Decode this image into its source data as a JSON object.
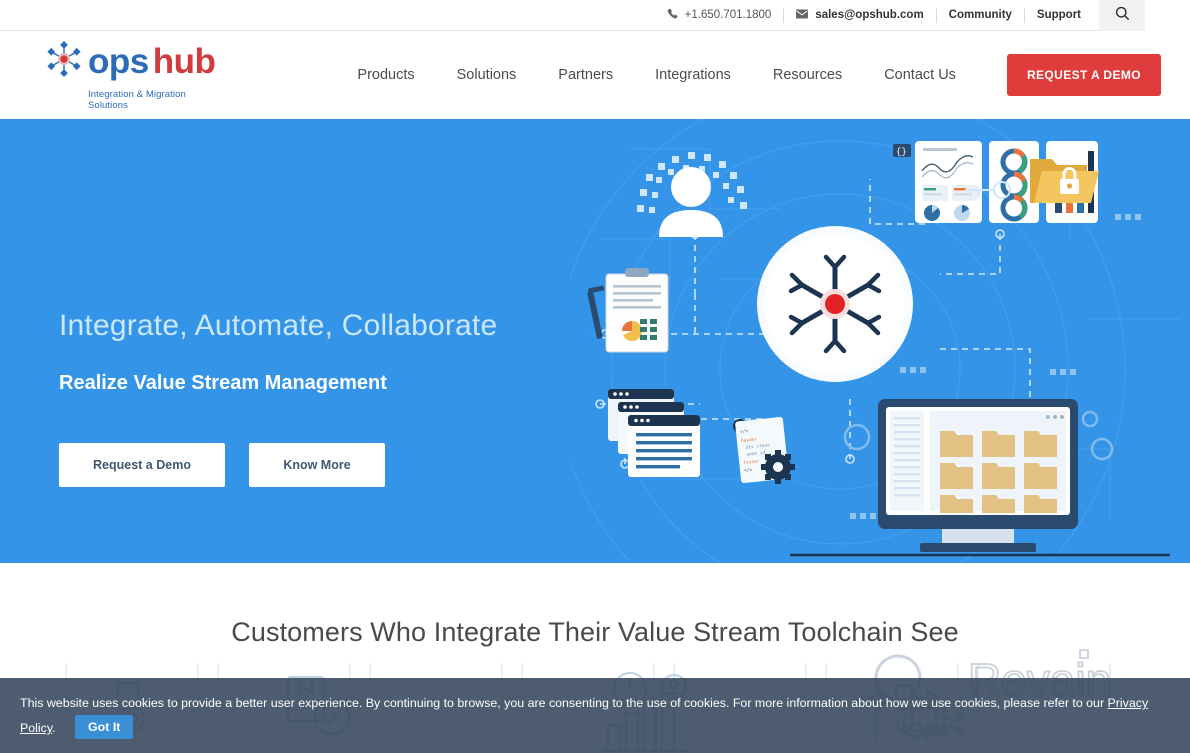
{
  "topbar": {
    "phone_icon": "phone-icon",
    "phone": "+1.650.701.1800",
    "email_icon": "envelope-icon",
    "email": "sales@opshub.com",
    "community": "Community",
    "support": "Support",
    "search_icon": "search-icon"
  },
  "brand": {
    "logo_icon": "hub-network-icon",
    "name_first": "ops",
    "name_second": "hub",
    "tagline": "Integration & Migration Solutions",
    "color_primary": "#2b6cb9",
    "color_accent": "#d13b3b"
  },
  "nav": {
    "items": [
      {
        "label": "Products"
      },
      {
        "label": "Solutions"
      },
      {
        "label": "Partners"
      },
      {
        "label": "Integrations"
      },
      {
        "label": "Resources"
      },
      {
        "label": "Contact Us"
      }
    ],
    "cta_label": "REQUEST A DEMO",
    "cta_color": "#e03c3c"
  },
  "hero": {
    "headline": "Integrate, Automate, Collaborate",
    "subheadline": "Realize Value Stream Management",
    "primary_button": "Request a Demo",
    "secondary_button": "Know More",
    "background_color": "#3394e8",
    "illustration": {
      "center_icon": "hub-network-icon",
      "nodes": [
        "user-avatar-icon",
        "report-clipboard-icon",
        "analytics-dashboard-icon",
        "donut-charts-icon",
        "bar-chart-icon",
        "checklist-documents-icon",
        "browser-windows-icon",
        "code-gear-document-icon",
        "monitor-folders-icon",
        "locked-folder-icon",
        "key-icon"
      ]
    }
  },
  "customers": {
    "heading": "Customers Who Integrate Their Value Stream Toolchain See",
    "background_icons": [
      "gear-document-icon",
      "quality-badge-icon",
      "growth-chart-clock-icon",
      "data-transfer-icon"
    ]
  },
  "watermark": {
    "text": "Revain",
    "icon": "monitor-chat-icon"
  },
  "cookie_banner": {
    "message_part1": "This website uses cookies to provide a better user experience. By continuing to browse, you are consenting to the use of cookies. For more information about how we use cookies, please refer to our",
    "link_label": "Privacy Policy",
    "message_end": ".",
    "button_label": "Got It",
    "button_color": "#3b8fd4"
  }
}
